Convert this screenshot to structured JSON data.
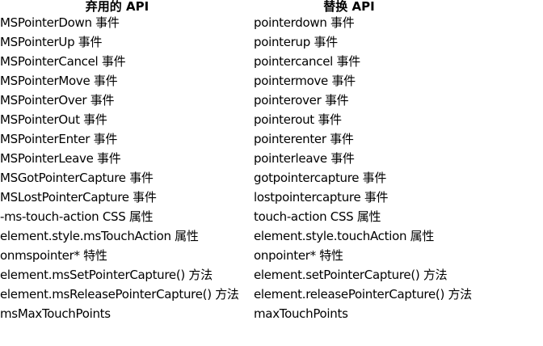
{
  "table": {
    "headers": [
      "弃用的 API",
      "替换 API"
    ],
    "rows": [
      [
        "MSPointerDown 事件",
        "pointerdown 事件"
      ],
      [
        "MSPointerUp 事件",
        "pointerup 事件"
      ],
      [
        "MSPointerCancel 事件",
        "pointercancel 事件"
      ],
      [
        "MSPointerMove 事件",
        "pointermove 事件"
      ],
      [
        "MSPointerOver 事件",
        "pointerover 事件"
      ],
      [
        "MSPointerOut 事件",
        "pointerout 事件"
      ],
      [
        "MSPointerEnter 事件",
        "pointerenter 事件"
      ],
      [
        "MSPointerLeave 事件",
        "pointerleave 事件"
      ],
      [
        "MSGotPointerCapture 事件",
        "gotpointercapture 事件"
      ],
      [
        "MSLostPointerCapture 事件",
        "lostpointercapture 事件"
      ],
      [
        "-ms-touch-action CSS 属性",
        "touch-action CSS 属性"
      ],
      [
        "element.style.msTouchAction 属性",
        "element.style.touchAction 属性"
      ],
      [
        "onmspointer* 特性",
        "onpointer* 特性"
      ],
      [
        "element.msSetPointerCapture() 方法",
        "element.setPointerCapture() 方法"
      ],
      [
        "element.msReleasePointerCapture() 方法",
        "element.releasePointerCapture() 方法"
      ],
      [
        "msMaxTouchPoints",
        "maxTouchPoints"
      ]
    ]
  }
}
